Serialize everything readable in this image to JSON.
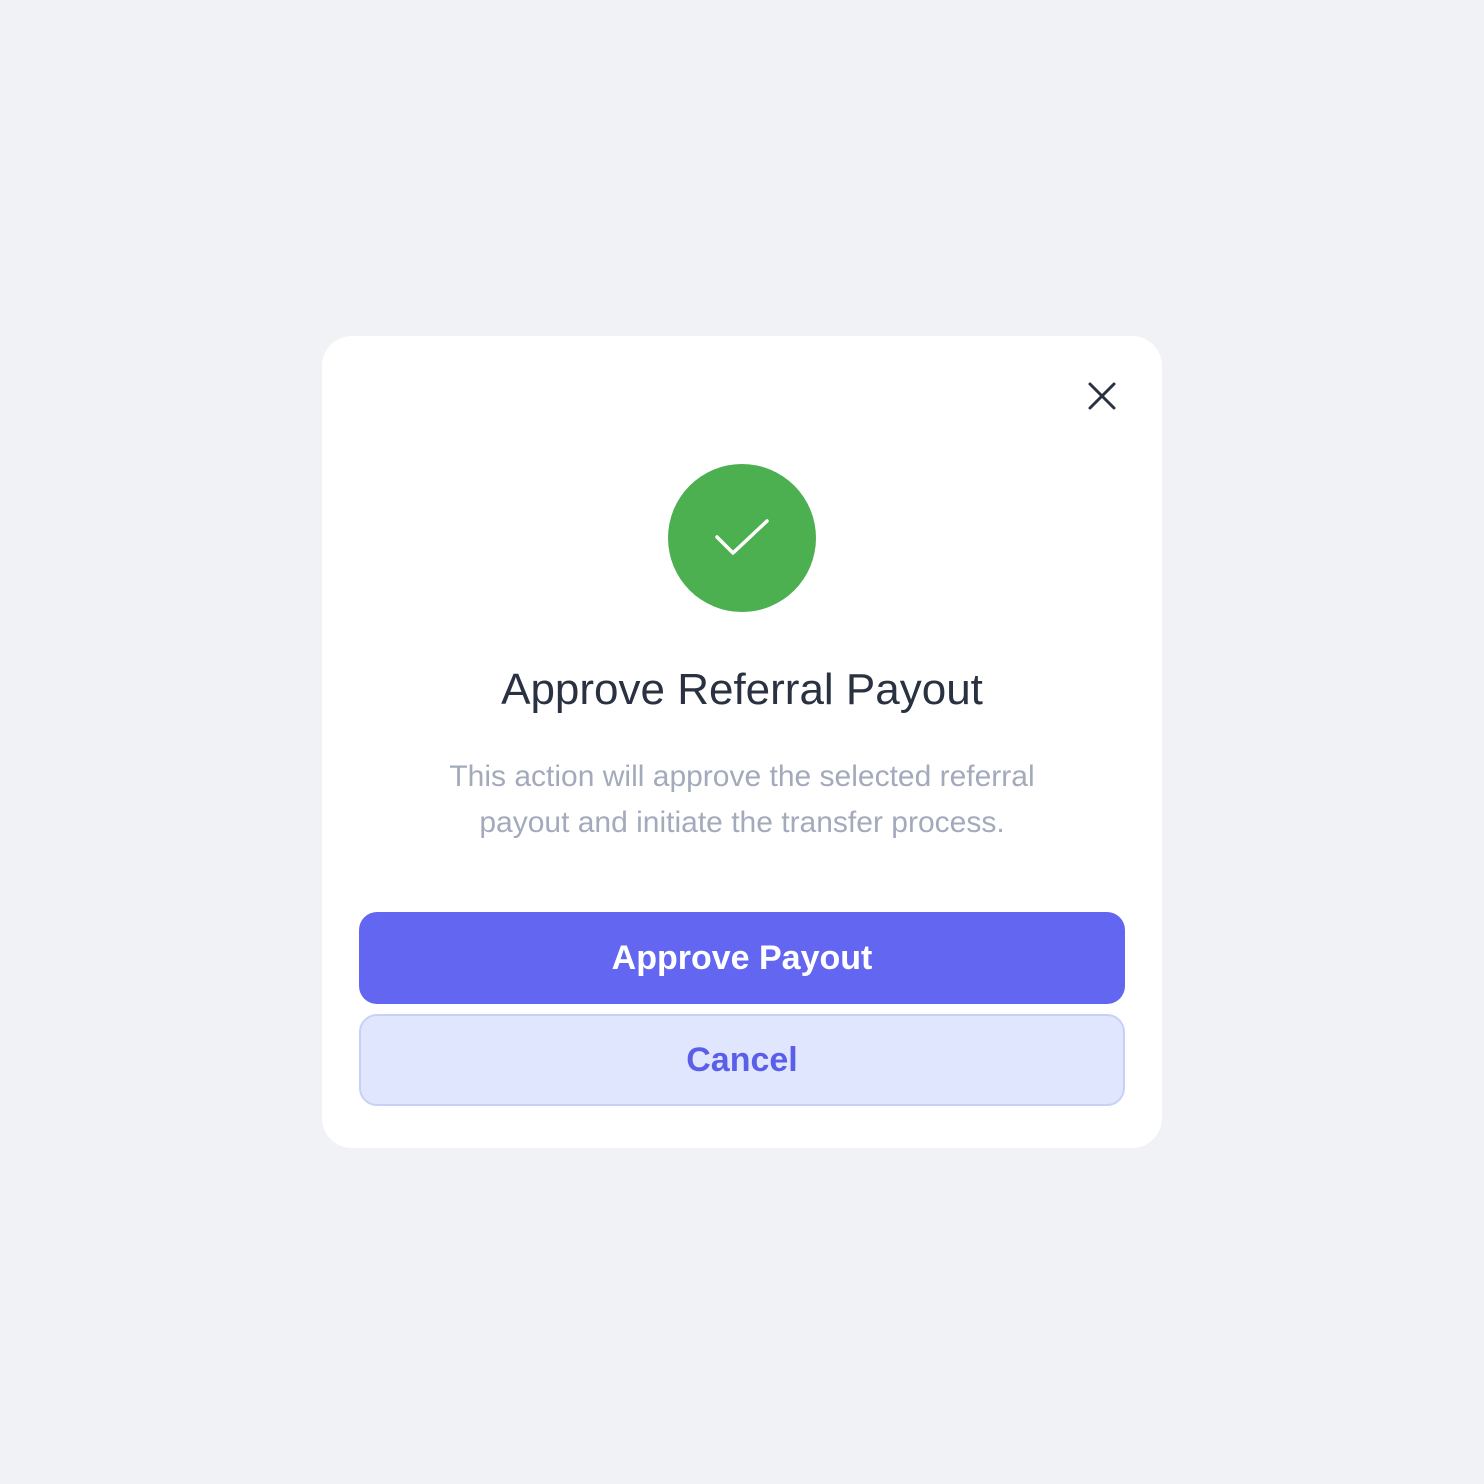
{
  "dialog": {
    "title": "Approve Referral Payout",
    "message": "This action will approve the selected referral payout and initiate the transfer process.",
    "status_icon": "check-circle-icon",
    "close_icon": "close-icon",
    "approve_label": "Approve Payout",
    "cancel_label": "Cancel"
  },
  "colors": {
    "background": "#f0f2f6",
    "success": "#4caf50",
    "primary": "#6366f1",
    "secondary_bg": "#e0e6fe",
    "title_text": "#2a3140",
    "message_text": "#a3aabc"
  }
}
